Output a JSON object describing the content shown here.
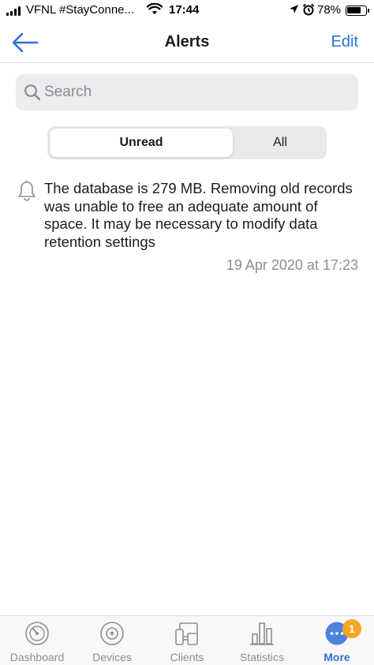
{
  "status_bar": {
    "carrier": "VFNL #StayConne...",
    "time": "17:44",
    "battery": "78%",
    "battery_level": 0.78,
    "icons": [
      "signal-icon",
      "wifi-icon",
      "location-icon",
      "alarm-icon",
      "battery-icon"
    ]
  },
  "nav": {
    "title": "Alerts",
    "edit_label": "Edit",
    "back_icon": "arrow-left-icon"
  },
  "search": {
    "placeholder": "Search",
    "value": ""
  },
  "segment": {
    "options": [
      "Unread",
      "All"
    ],
    "selected": "Unread"
  },
  "alerts": [
    {
      "icon": "bell-icon",
      "message": "The database is 279 MB. Removing old records was unable to free an adequate amount of space. It may be necessary to modify data retention settings",
      "timestamp": "19 Apr 2020 at 17:23"
    }
  ],
  "tabbar": {
    "items": [
      {
        "label": "Dashboard",
        "icon": "dashboard-icon"
      },
      {
        "label": "Devices",
        "icon": "devices-icon"
      },
      {
        "label": "Clients",
        "icon": "clients-icon"
      },
      {
        "label": "Statistics",
        "icon": "statistics-icon"
      },
      {
        "label": "More",
        "icon": "more-icon"
      }
    ],
    "active": "More",
    "badge": "1"
  },
  "colors": {
    "accent": "#2f6fd9",
    "badge": "#f5a623",
    "secondary_text": "#8d8d92"
  }
}
